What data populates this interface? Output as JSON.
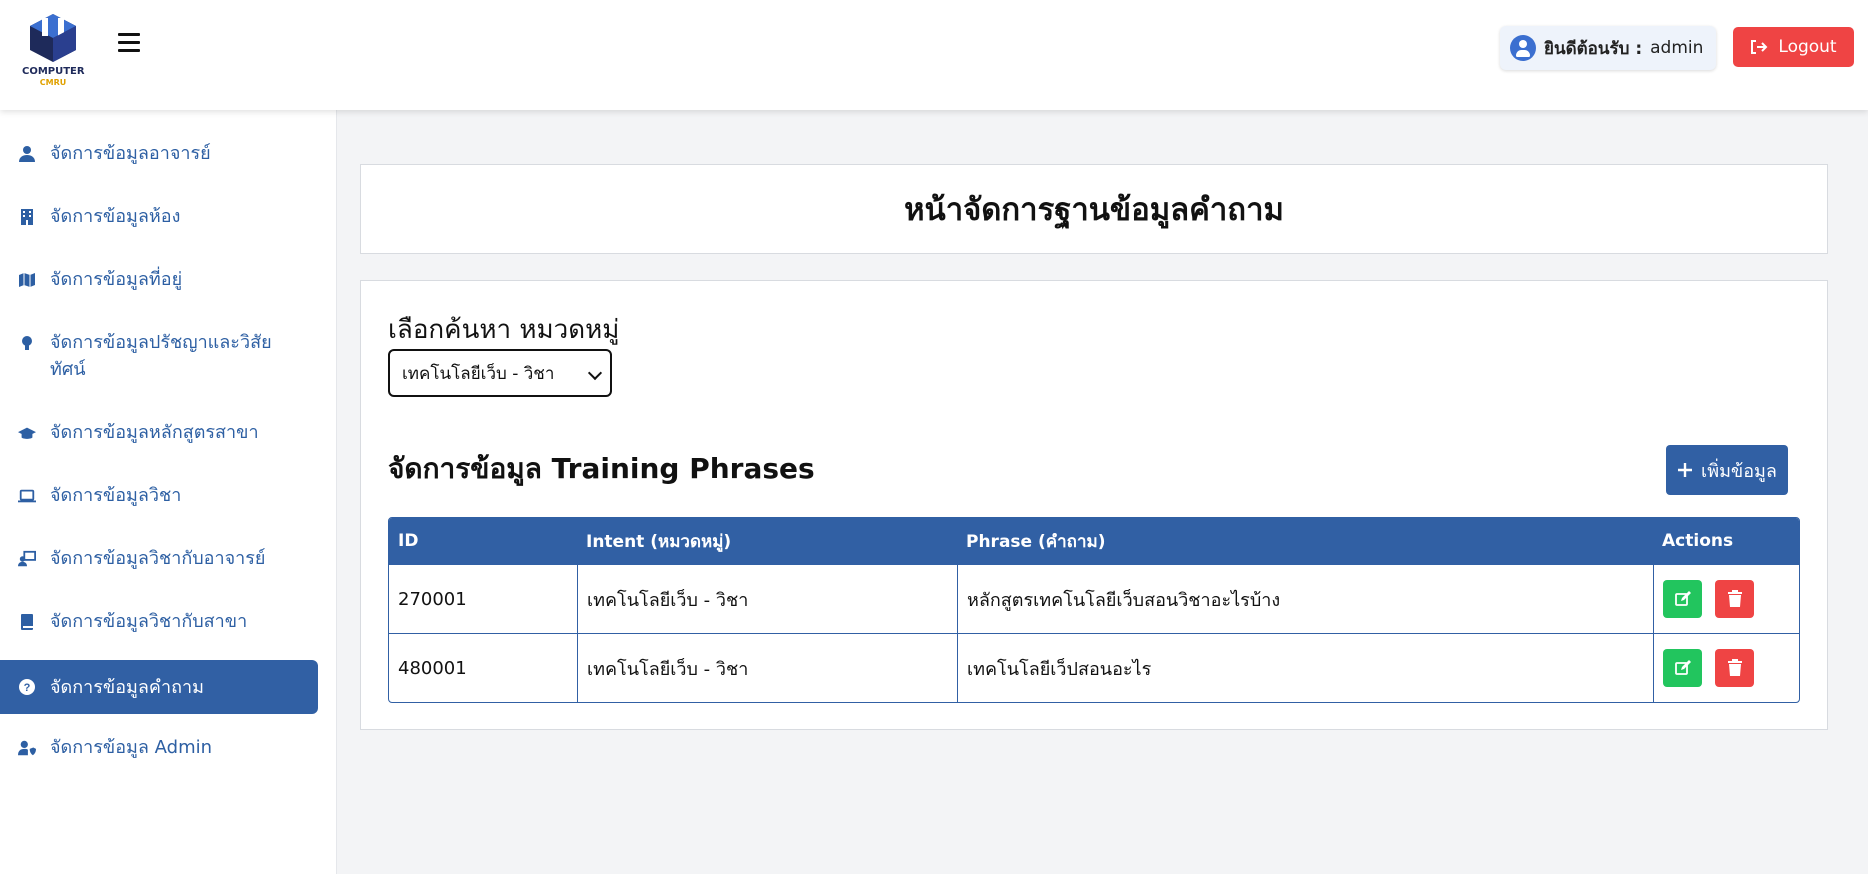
{
  "brand": {
    "logo_text": "COMPUTER",
    "logo_sub": "CMRU"
  },
  "header": {
    "welcome_label": "ยินดีต้อนรับ :",
    "username": "admin",
    "logout_label": "Logout"
  },
  "sidebar": {
    "items": [
      {
        "label": "จัดการข้อมูลอาจารย์",
        "icon": "user-icon"
      },
      {
        "label": "จัดการข้อมูลห้อง",
        "icon": "building-icon"
      },
      {
        "label": "จัดการข้อมูลที่อยู่",
        "icon": "map-icon"
      },
      {
        "label": "จัดการข้อมูลปรัชญาและวิสัยทัศน์",
        "icon": "lightbulb-icon"
      },
      {
        "label": "จัดการข้อมูลหลักสูตรสาขา",
        "icon": "graduation-cap-icon"
      },
      {
        "label": "จัดการข้อมูลวิชา",
        "icon": "laptop-code-icon"
      },
      {
        "label": "จัดการข้อมูลวิชากับอาจารย์",
        "icon": "chalkboard-teacher-icon"
      },
      {
        "label": "จัดการข้อมูลวิชากับสาขา",
        "icon": "book-icon"
      },
      {
        "label": "จัดการข้อมูลคำถาม",
        "icon": "question-circle-icon",
        "active": true
      },
      {
        "label": "จัดการข้อมูล Admin",
        "icon": "user-shield-icon"
      }
    ]
  },
  "main": {
    "title": "หน้าจัดการฐานข้อมูลคำถาม",
    "filter_label": "เลือกค้นหา หมวดหมู่",
    "filter_value": "เทคโนโลยีเว็บ - วิชา",
    "section_title": "จัดการข้อมูล Training Phrases",
    "add_button": "เพิ่มข้อมูล",
    "table": {
      "headers": [
        "ID",
        "Intent (หมวดหมู่)",
        "Phrase (คำถาม)",
        "Actions"
      ],
      "rows": [
        {
          "id": "270001",
          "intent": "เทคโนโลยีเว็บ - วิชา",
          "phrase": "หลักสูตรเทคโนโลยีเว็บสอนวิชาอะไรบ้าง"
        },
        {
          "id": "480001",
          "intent": "เทคโนโลยีเว็บ - วิชา",
          "phrase": "เทคโนโลยีเว็ปสอนอะไร"
        }
      ]
    }
  },
  "colors": {
    "primary": "#3160a4",
    "danger": "#ef4444",
    "success": "#22c55e"
  }
}
